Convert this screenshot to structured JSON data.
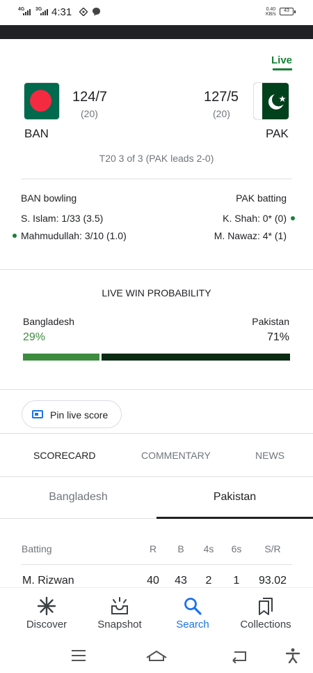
{
  "status_bar": {
    "net1": "4G",
    "net2": "3G",
    "time": "4:31",
    "speed_value": "0.40",
    "speed_unit": "KB/s",
    "battery": "43"
  },
  "live_label": "Live",
  "teams": {
    "home": {
      "name": "BAN",
      "score": "124/7",
      "overs": "(20)"
    },
    "away": {
      "name": "PAK",
      "score": "127/5",
      "overs": "(20)"
    }
  },
  "match_info": "T20 3 of 3 (PAK leads 2-0)",
  "bowling": {
    "label": "BAN bowling",
    "players": [
      "S. Islam: 1/33 (3.5)",
      "Mahmudullah: 3/10 (1.0)"
    ]
  },
  "batting": {
    "label": "PAK batting",
    "players": [
      "K. Shah: 0* (0)",
      "M. Nawaz: 4* (1)"
    ]
  },
  "win_probability": {
    "title": "LIVE WIN PROBABILITY",
    "home": {
      "team": "Bangladesh",
      "pct": "29%",
      "value": 29,
      "color": "#3d8c40"
    },
    "away": {
      "team": "Pakistan",
      "pct": "71%",
      "value": 71,
      "color": "#0b2a12"
    }
  },
  "pin_button": "Pin live score",
  "tabs": [
    "SCORECARD",
    "COMMENTARY",
    "NEWS"
  ],
  "team_tabs": [
    "Bangladesh",
    "Pakistan"
  ],
  "scorecard": {
    "headers": [
      "Batting",
      "R",
      "B",
      "4s",
      "6s",
      "S/R"
    ],
    "rows": [
      [
        "M. Rizwan",
        "40",
        "43",
        "2",
        "1",
        "93.02"
      ]
    ]
  },
  "bottom_nav": [
    "Discover",
    "Snapshot",
    "Search",
    "Collections"
  ],
  "accent_color": "#1a73e8",
  "live_color": "#188038"
}
